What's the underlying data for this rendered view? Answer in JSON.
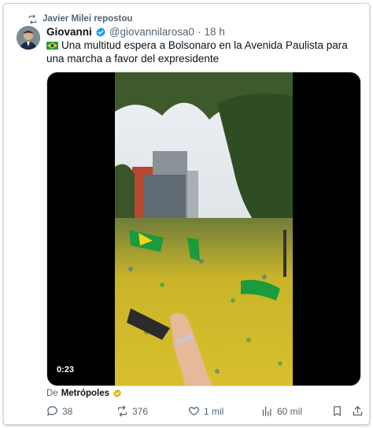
{
  "repost": {
    "label": "Javier Milei repostou"
  },
  "post": {
    "author_name": "Giovanni",
    "handle": "@giovannilarosa0",
    "separator": "·",
    "time": "18 h",
    "text": "Una multitud espera a Bolsonaro en la Avenida Paulista para una marcha a favor del expresidente",
    "media": {
      "duration": "0:23"
    },
    "source_prefix": "De",
    "source_name": "Metrópoles"
  },
  "actions": {
    "replies": "38",
    "reposts": "376",
    "likes": "1 mil",
    "views": "60 mil"
  },
  "colors": {
    "accent": "#1d9bf0",
    "muted": "#536471",
    "gold_badge": "#e2b719"
  }
}
